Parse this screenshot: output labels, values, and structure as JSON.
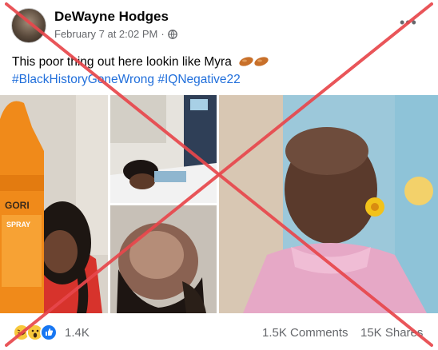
{
  "post": {
    "author": "DeWayne Hodges",
    "timestamp": "February 7 at 2:02 PM",
    "separator": "·",
    "privacy_icon": "globe-icon",
    "menu_icon": "more-options-icon",
    "menu_glyph": "•••",
    "caption": "This poor thing out here lookin like Myra",
    "caption_emoji": "peanut-emoji x2",
    "hashtags": [
      "#BlackHistoryGoneWrong",
      "#IQNegative22"
    ]
  },
  "photo_labels": {
    "bottle_brand": "GORI",
    "bottle_word": "SPRAY"
  },
  "footer": {
    "reaction_icons": [
      "haha-reaction-icon",
      "wow-reaction-icon",
      "like-reaction-icon"
    ],
    "reactions_count": "1.4K",
    "comments": "1.5K Comments",
    "shares": "15K Shares"
  },
  "colors": {
    "cross_red": "#e8474c",
    "hashtag_blue": "#216fdb",
    "meta_gray": "#65676b"
  }
}
